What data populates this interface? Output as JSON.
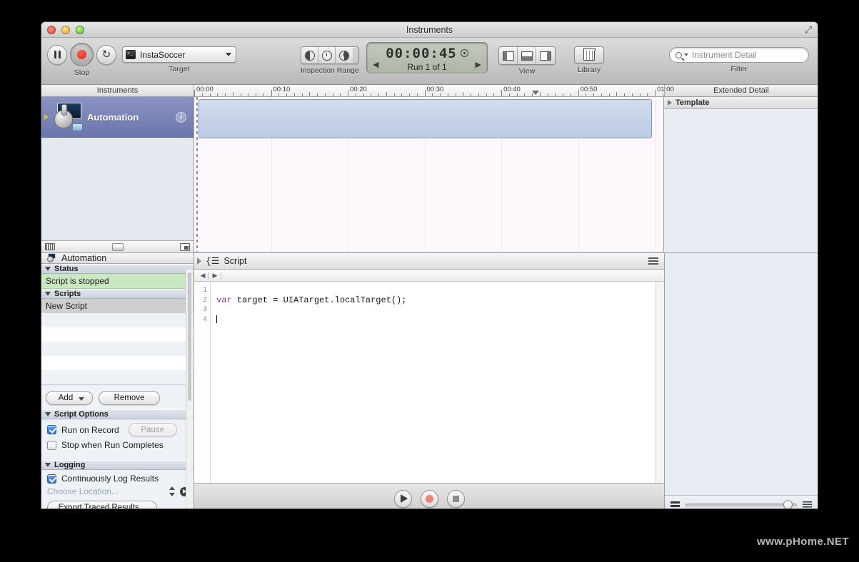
{
  "window": {
    "title": "Instruments",
    "traffic_lights": [
      "close",
      "minimize",
      "zoom"
    ],
    "fullscreen_icon": "fullscreen-icon"
  },
  "toolbar": {
    "record_group": {
      "label": "Stop",
      "pause_icon": "pause-icon",
      "record_icon": "record-icon",
      "loop_icon": "loop-icon"
    },
    "target": {
      "label": "Target",
      "value": "InstaSoccer",
      "app_icon": "terminal-app-icon",
      "caret_icon": "chevron-down-icon"
    },
    "inspection_range": {
      "label": "Inspection Range",
      "buttons": [
        "set-range-start-icon",
        "clear-range-icon",
        "set-range-end-icon"
      ]
    },
    "timer": {
      "time": "00:00:45",
      "run": "Run 1 of 1",
      "gear_icon": "target-icon",
      "prev_icon": "previous-run-icon",
      "next_icon": "next-run-icon"
    },
    "view": {
      "label": "View",
      "buttons": [
        "show-instruments-panel-icon",
        "show-detail-panel-icon",
        "show-extended-detail-icon"
      ]
    },
    "library": {
      "label": "Library",
      "icon": "library-icon"
    },
    "filter": {
      "label": "Filter",
      "placeholder": "Instrument Detail",
      "value": "",
      "search_icon": "search-icon"
    }
  },
  "columns": {
    "instruments": "Instruments",
    "extended_detail": "Extended Detail"
  },
  "ruler": {
    "labels": [
      "00:00",
      "00:10",
      "00:20",
      "00:30",
      "00:40",
      "00:50",
      "01:00"
    ],
    "playhead_label": "playhead-marker"
  },
  "instruments_pane": {
    "rows": [
      {
        "name": "Automation",
        "icon": "automation-instrument-icon",
        "info": "i",
        "selected": true
      }
    ],
    "footer_icons": [
      "track-view-icon",
      "split-view-icon",
      "detail-view-icon"
    ]
  },
  "extended_detail": {
    "title": "Extended Detail",
    "rows": [
      {
        "label": "Template",
        "expanded": false
      }
    ]
  },
  "detail_pane": {
    "header": {
      "title": "Automation",
      "icon": "automation-icon"
    },
    "sections": {
      "status": {
        "title": "Status",
        "message": "Script is stopped"
      },
      "scripts": {
        "title": "Scripts",
        "items": [
          "New Script"
        ],
        "selected_index": 0,
        "add_label": "Add",
        "remove_label": "Remove"
      },
      "script_options": {
        "title": "Script Options",
        "run_on_record": {
          "label": "Run on Record",
          "checked": true
        },
        "pause_label": "Pause",
        "pause_enabled": false,
        "stop_when_complete": {
          "label": "Stop when Run Completes",
          "checked": false
        }
      },
      "logging": {
        "title": "Logging",
        "continuously_log": {
          "label": "Continuously Log Results",
          "checked": true
        },
        "choose_location": "Choose Location...",
        "export_label": "Export Traced Results..."
      }
    }
  },
  "script_pane": {
    "title": "Script",
    "icon": "script-icon",
    "menu_icon": "hamburger-icon",
    "nav": {
      "back_icon": "nav-back-icon",
      "forward_icon": "nav-forward-icon"
    },
    "line_numbers": [
      "1",
      "2",
      "3",
      "4"
    ],
    "code_lines": [
      {
        "text": "",
        "parts": []
      },
      {
        "parts": [
          {
            "t": "var",
            "c": "kw"
          },
          {
            "t": " target = UIATarget.localTarget();",
            "c": ""
          }
        ]
      },
      {
        "text": "",
        "parts": []
      },
      {
        "text": "",
        "parts": [],
        "caret": true
      }
    ],
    "transport": {
      "play_icon": "play-icon",
      "record_icon": "record-icon",
      "stop_icon": "stop-icon"
    }
  },
  "footer": {
    "zoom_out_icon": "zoom-out-icon",
    "zoom_in_icon": "zoom-list-icon",
    "slider_value": 92
  },
  "watermark": "www.pHome.NET",
  "colors": {
    "selection_blue": "#6d76ab",
    "status_green": "#c9e8c1",
    "record_red": "#d82a14",
    "keyword_purple": "#a626a4"
  }
}
